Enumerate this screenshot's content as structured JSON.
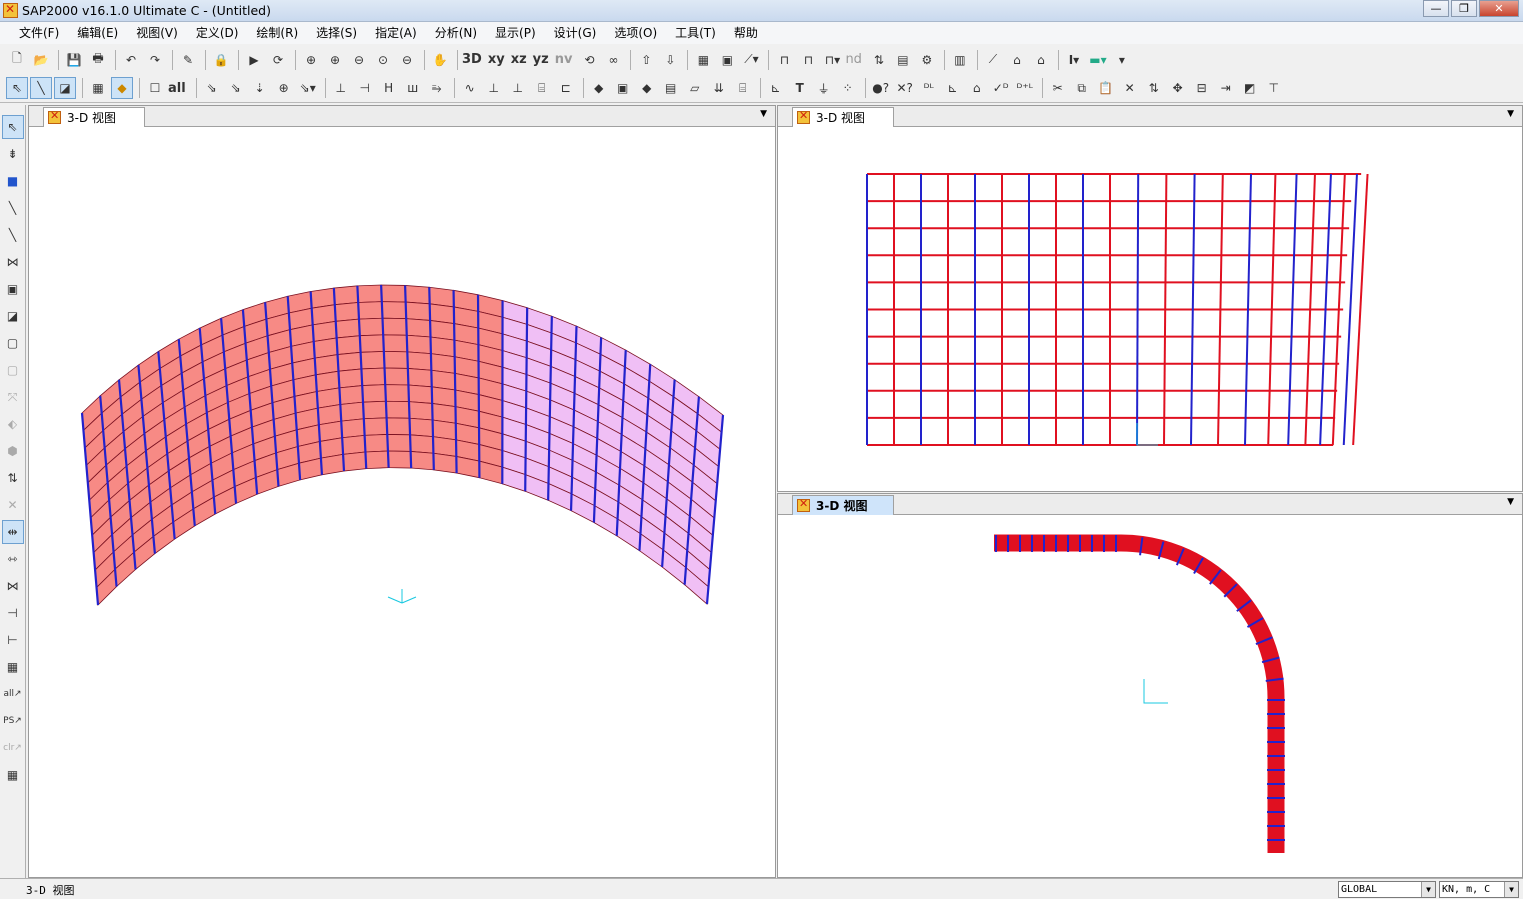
{
  "window": {
    "title": "SAP2000 v16.1.0 Ultimate C - (Untitled)",
    "minimize": "—",
    "restore": "❐",
    "close": "✕"
  },
  "menu": [
    "文件(F)",
    "编辑(E)",
    "视图(V)",
    "定义(D)",
    "绘制(R)",
    "选择(S)",
    "指定(A)",
    "分析(N)",
    "显示(P)",
    "设计(G)",
    "选项(O)",
    "工具(T)",
    "帮助"
  ],
  "toolbar1": {
    "view_labels": [
      "3D",
      "xy",
      "xz",
      "yz",
      "nv"
    ],
    "icons": [
      "new-icon",
      "open-icon",
      "save-icon",
      "print-icon",
      "undo-icon",
      "redo-icon",
      "edit-icon",
      "lock-icon",
      "run-icon",
      "refresh-icon",
      "zoom-window-icon",
      "zoom-in-icon",
      "zoom-out-icon",
      "zoom-fit-icon",
      "zoom-prev-icon",
      "pan-icon"
    ]
  },
  "toolbar2": {
    "all_label": "all"
  },
  "panes": {
    "left": {
      "tab": "3-D 视图"
    },
    "right_top": {
      "tab": "3-D 视图"
    },
    "right_bottom": {
      "tab": "3-D 视图"
    }
  },
  "colors": {
    "shell_fill": "#f78a85",
    "shell_fill_light": "#f0bff5",
    "frame_blue": "#2222cc",
    "frame_red": "#e01020",
    "axis_cyan": "#18c8e0"
  },
  "status": {
    "text": "3-D 视图",
    "coord_system": "GLOBAL",
    "units": "KN, m, C"
  }
}
